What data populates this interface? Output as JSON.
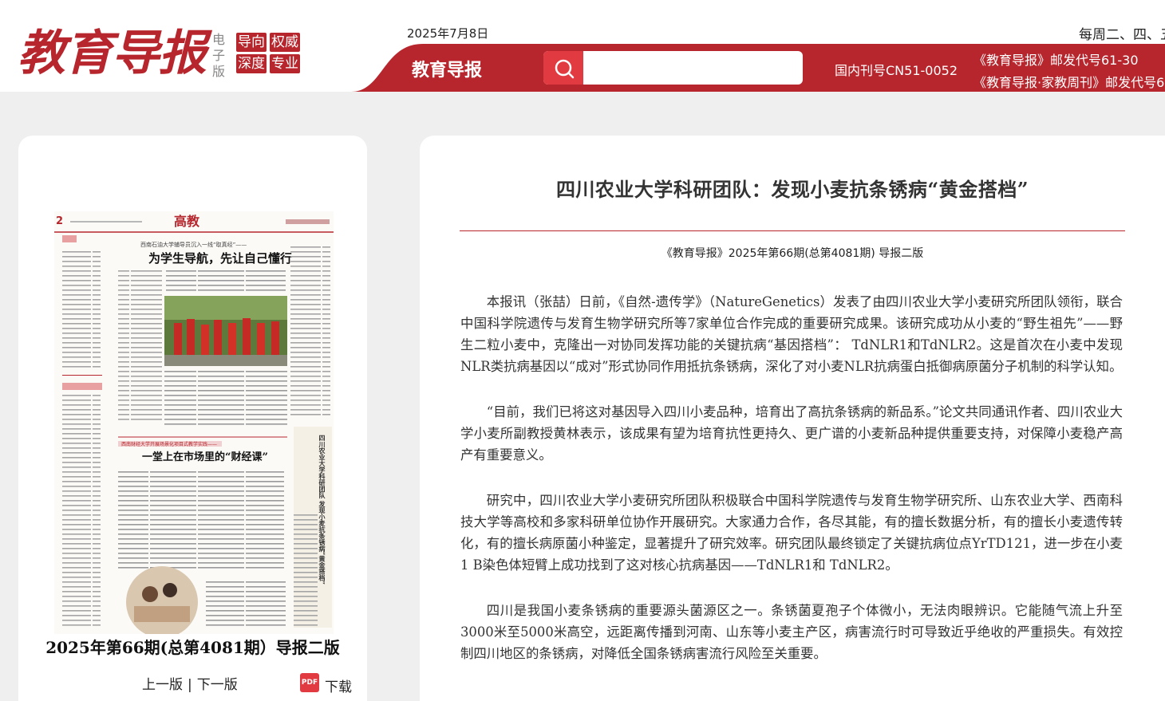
{
  "header": {
    "logo_text": "教育导报",
    "edition": "电子版",
    "tags": [
      "导向",
      "权威",
      "深度",
      "专业"
    ],
    "date": "2025年7月8日",
    "frequency": "每周二、四、五",
    "bar_title": "教育导报",
    "search": {
      "placeholder": "",
      "icon": "search-icon"
    },
    "issn": "国内刊号CN51-0052",
    "postcode_1": "《教育导报》邮发代号61-30",
    "postcode_2": "《教育导报·家教周刊》邮发代号6"
  },
  "left_panel": {
    "thumbnail": {
      "page_no": "2",
      "section": "高教",
      "headline_1": "为学生导航，先让自己懂行",
      "kicker_1": "西南石油大学辅导员沉入一线“取真经”——",
      "headline_2": "一堂上在市场里的“财经课”",
      "kicker_2": "西南财经大学开展场景化项目式教学实践——",
      "side_title": "四川农业大学科研团队 发现小麦抗条锈病“黄金搭档”"
    },
    "issue_label": "2025年第66期(总第4081期）导报二版",
    "prev_label": "上一版",
    "separator": "|",
    "next_label": "下一版",
    "pdf_icon": "PDF",
    "download_label": "下载"
  },
  "article": {
    "title": "四川农业大学科研团队：发现小麦抗条锈病“黄金搭档”",
    "source": "《教育导报》2025年第66期(总第4081期) 导报二版",
    "paragraphs": [
      "本报讯（张喆）日前，《自然-遗传学》（NatureGenetics）发表了由四川农业大学小麦研究所团队领衔，联合中国科学院遗传与发育生物学研究所等7家单位合作完成的重要研究成果。该研究成功从小麦的“野生祖先”——野生二粒小麦中，克隆出一对协同发挥功能的关键抗病“基因搭档”： TdNLR1和TdNLR2。这是首次在小麦中发现 NLR类抗病基因以“成对”形式协同作用抵抗条锈病，深化了对小麦NLR抗病蛋白抵御病原菌分子机制的科学认知。",
      "“目前，我们已将这对基因导入四川小麦品种，培育出了高抗条锈病的新品系。”论文共同通讯作者、四川农业大学小麦所副教授黄林表示，该成果有望为培育抗性更持久、更广谱的小麦新品种提供重要支持，对保障小麦稳产高产有重要意义。",
      "研究中，四川农业大学小麦研究所团队积极联合中国科学院遗传与发育生物学研究所、山东农业大学、西南科技大学等高校和多家科研单位协作开展研究。大家通力合作，各尽其能，有的擅长数据分析，有的擅长小麦遗传转化，有的擅长病原菌小种鉴定，显著提升了研究效率。研究团队最终锁定了关键抗病位点YrTD121，进一步在小麦1 B染色体短臂上成功找到了这对核心抗病基因——TdNLR1和 TdNLR2。",
      "四川是我国小麦条锈病的重要源头菌源区之一。条锈菌夏孢子个体微小，无法肉眼辨识。它能随气流上升至3000米至5000米高空，远距离传播到河南、山东等小麦主产区，病害流行时可导致近乎绝收的严重损失。有效控制四川地区的条锈病，对降低全国条锈病害流行风险至关重要。"
    ]
  },
  "colors": {
    "brand_red": "#b8262d",
    "search_red": "#e23a41",
    "page_bg": "#efefef"
  }
}
